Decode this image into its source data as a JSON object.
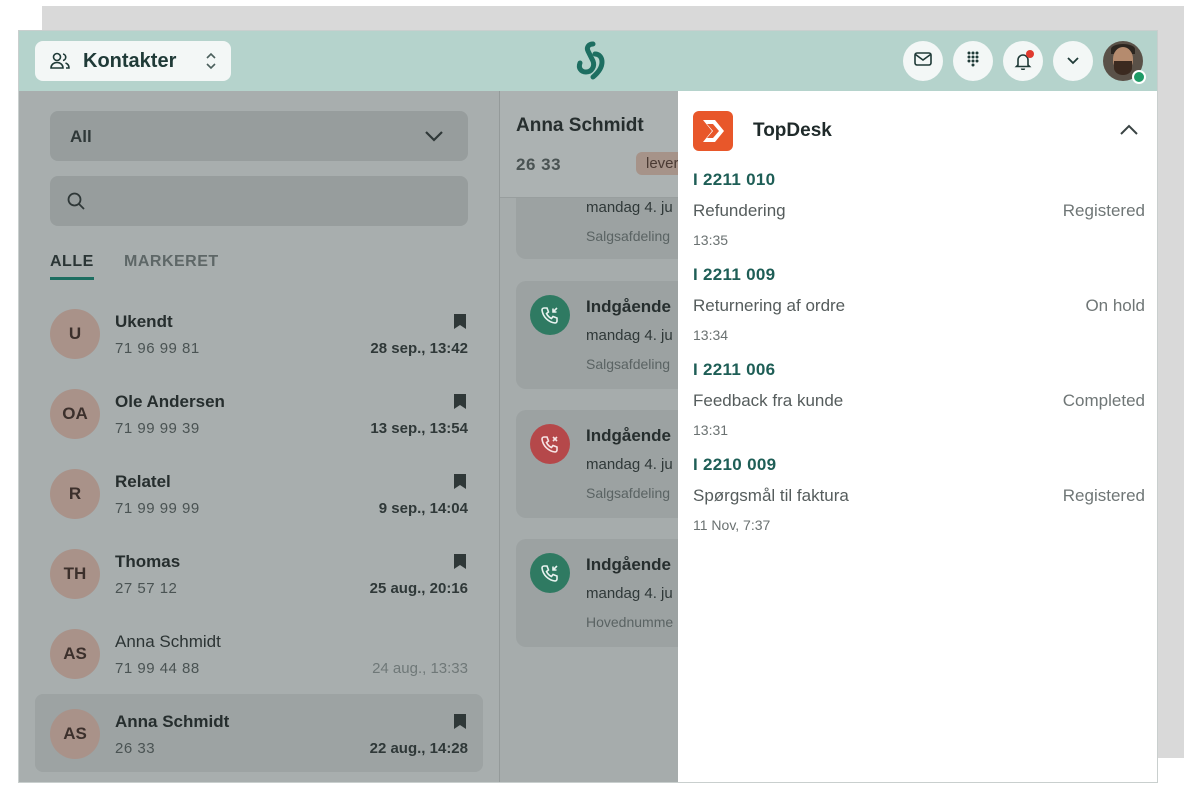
{
  "header": {
    "switcher_label": "Kontakter",
    "icons": [
      "contacts-icon",
      "updown-icon",
      "mail-icon",
      "dialpad-icon",
      "bell-icon",
      "chevron-down-icon",
      "avatar"
    ],
    "brand_color": "#b5d3cc"
  },
  "left": {
    "filter_value": "All",
    "search_placeholder": "",
    "tabs": [
      {
        "label": "ALLE",
        "active": true
      },
      {
        "label": "MARKERET",
        "active": false
      }
    ],
    "contacts": [
      {
        "initials": "U",
        "name": "Ukendt",
        "number": "71 96 99 81",
        "time": "28 sep., 13:42",
        "bookmarked": true,
        "selected": false
      },
      {
        "initials": "OA",
        "name": "Ole Andersen",
        "number": "71 99 99 39",
        "time": "13 sep., 13:54",
        "bookmarked": true,
        "selected": false
      },
      {
        "initials": "R",
        "name": "Relatel",
        "number": "71 99 99 99",
        "time": "9 sep., 14:04",
        "bookmarked": true,
        "selected": false
      },
      {
        "initials": "TH",
        "name": "Thomas",
        "number": "27 57 12",
        "time": "25 aug., 20:16",
        "bookmarked": true,
        "selected": false
      },
      {
        "initials": "AS",
        "name": "Anna Schmidt",
        "number": "71 99 44 88",
        "time": "24 aug., 13:33",
        "bookmarked": false,
        "selected": false
      },
      {
        "initials": "AS",
        "name": "Anna Schmidt",
        "number": "26 33",
        "time": "22 aug., 14:28",
        "bookmarked": true,
        "selected": true
      }
    ]
  },
  "middle": {
    "name": "Anna Schmidt",
    "number": "26 33",
    "badge": "lever",
    "calls": [
      {
        "title": "",
        "date": "mandag 4. ju",
        "dept": "Salgsafdeling",
        "kind": "in"
      },
      {
        "title": "Indgående",
        "date": "mandag 4. ju",
        "dept": "Salgsafdeling",
        "kind": "in"
      },
      {
        "title": "Indgående",
        "date": "mandag 4. ju",
        "dept": "Salgsafdeling",
        "kind": "missed"
      },
      {
        "title": "Indgående",
        "date": "mandag 4. ju",
        "dept": "Hovednumme",
        "kind": "in"
      }
    ]
  },
  "topdesk": {
    "title": "TopDesk",
    "tickets": [
      {
        "id": "I 2211 010",
        "subject": "Refundering",
        "status": "Registered",
        "time": "13:35"
      },
      {
        "id": "I 2211 009",
        "subject": "Returnering af ordre",
        "status": "On hold",
        "time": "13:34"
      },
      {
        "id": "I 2211 006",
        "subject": "Feedback fra kunde",
        "status": "Completed",
        "time": "13:31"
      },
      {
        "id": "I 2210 009",
        "subject": "Spørgsmål til faktura",
        "status": "Registered",
        "time": "11 Nov, 7:37"
      }
    ]
  }
}
